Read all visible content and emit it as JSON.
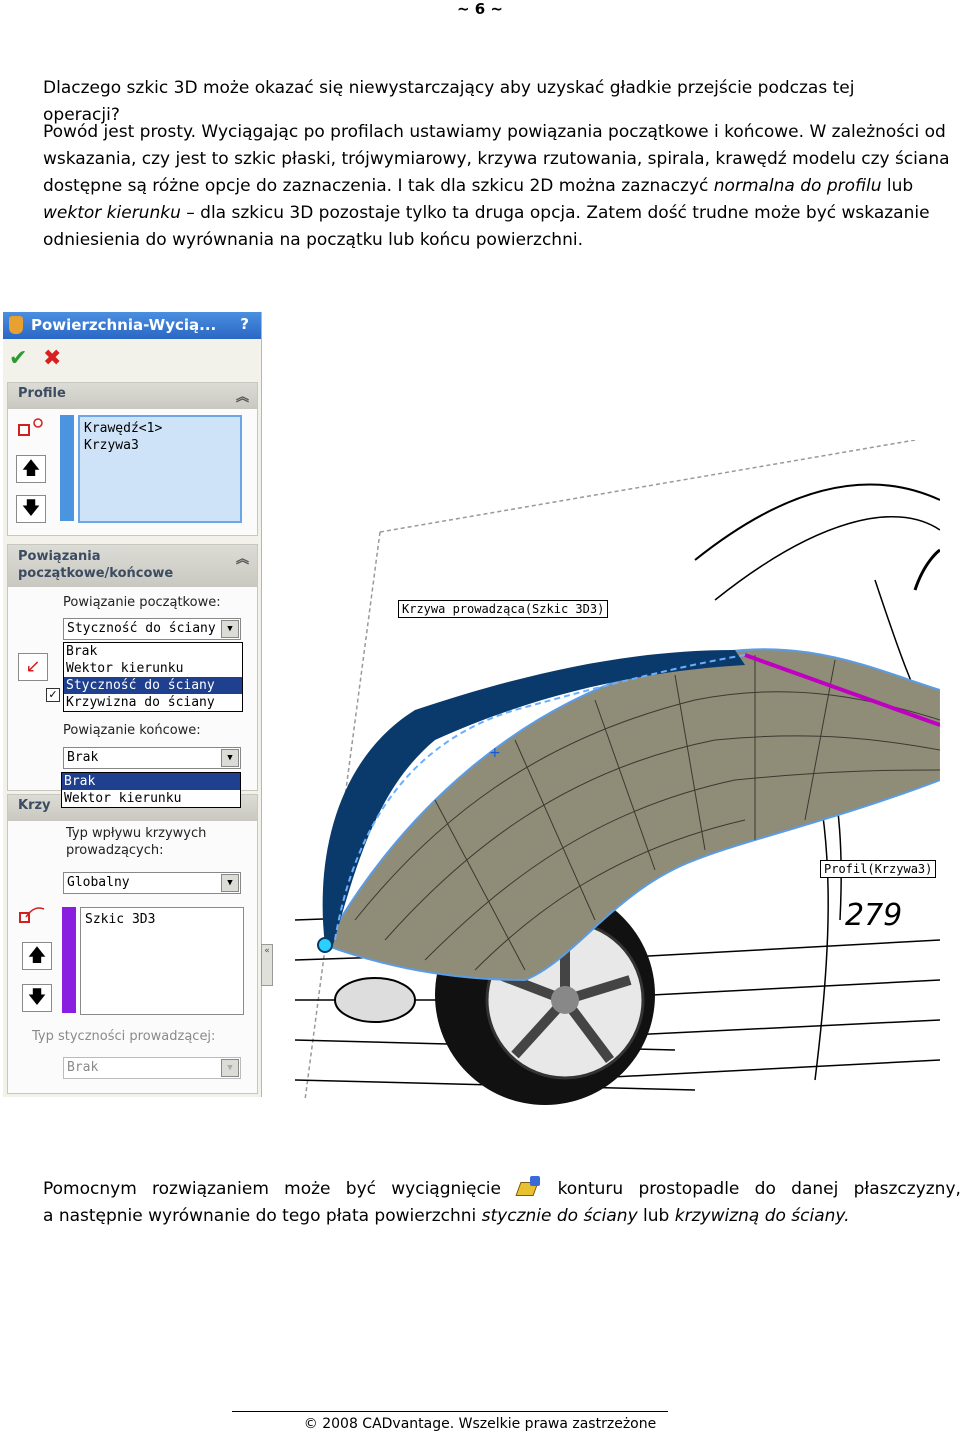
{
  "page_number": "~ 6 ~",
  "question": "Dlaczego szkic 3D może okazać się niewystarczający aby uzyskać gładkie przejście podczas tej operacji?",
  "paragraph1": {
    "a": "Powód jest prosty. Wyciągając po profilach ustawiamy powiązania początkowe i końcowe. W zależności od wskazania, czy jest to szkic płaski, trójwymiarowy, krzywa rzutowania, spirala, krawędź modelu czy ściana dostępne są różne opcje do zaznaczenia. I tak dla szkicu 2D można zaznaczyć ",
    "b": "normalna do profilu",
    "c": " lub ",
    "d": "wektor kierunku",
    "e": " – dla szkicu 3D pozostaje tylko ta druga opcja. Zatem dość trudne może być wskazanie odniesienia do wyrównania na początku lub końcu powierzchni."
  },
  "panel": {
    "title": "Powierzchnia-Wycią...",
    "help": "?",
    "profile_header": "Profile",
    "profile_items": [
      "Krawędź<1>",
      "Krzywa3"
    ],
    "constraints_header_1": "Powiązania",
    "constraints_header_2": "początkowe/końcowe",
    "start_label": "Powiązanie początkowe:",
    "start_value": "Styczność do ściany",
    "start_options": [
      "Brak",
      "Wektor kierunku",
      "Styczność do ściany",
      "Krzywizna do ściany"
    ],
    "end_label": "Powiązanie końcowe:",
    "end_value": "Brak",
    "end_options": [
      "Brak",
      "Wektor kierunku"
    ],
    "guides_header": "Krzy",
    "influence_label_1": "Typ wpływu krzywych",
    "influence_label_2": "prowadzących:",
    "influence_value": "Globalny",
    "guide_items": [
      "Szkic 3D3"
    ],
    "tangency_label": "Typ styczności prowadzącej:",
    "tangency_value": "Brak"
  },
  "viewport": {
    "guide_curve_label": "Krzywa prowadząca(Szkic 3D3)",
    "profile_label": "Profil(Krzywa3)",
    "plate_text": "279"
  },
  "paragraph2": {
    "line1_words": [
      "Pomocnym",
      "rozwiązaniem",
      "może",
      "być",
      "wyciągnięcie",
      "[icon]",
      "konturu",
      "prostopadle",
      "do",
      "danej",
      "płaszczyzny,"
    ],
    "line2_a": "a następnie wyrównanie do tego płata powierzchni ",
    "line2_b": "stycznie do ściany",
    "line2_c": " lub ",
    "line2_d": "krzywizną do ściany."
  },
  "footer": "© 2008 CADvantage. Wszelkie prawa zastrzeżone",
  "colors": {
    "title_bar": "#2a67c5",
    "surface": "#8f8c78",
    "edge": "#0a3a6b",
    "guide": "#c000c0",
    "selection": "#1f3f8f"
  }
}
